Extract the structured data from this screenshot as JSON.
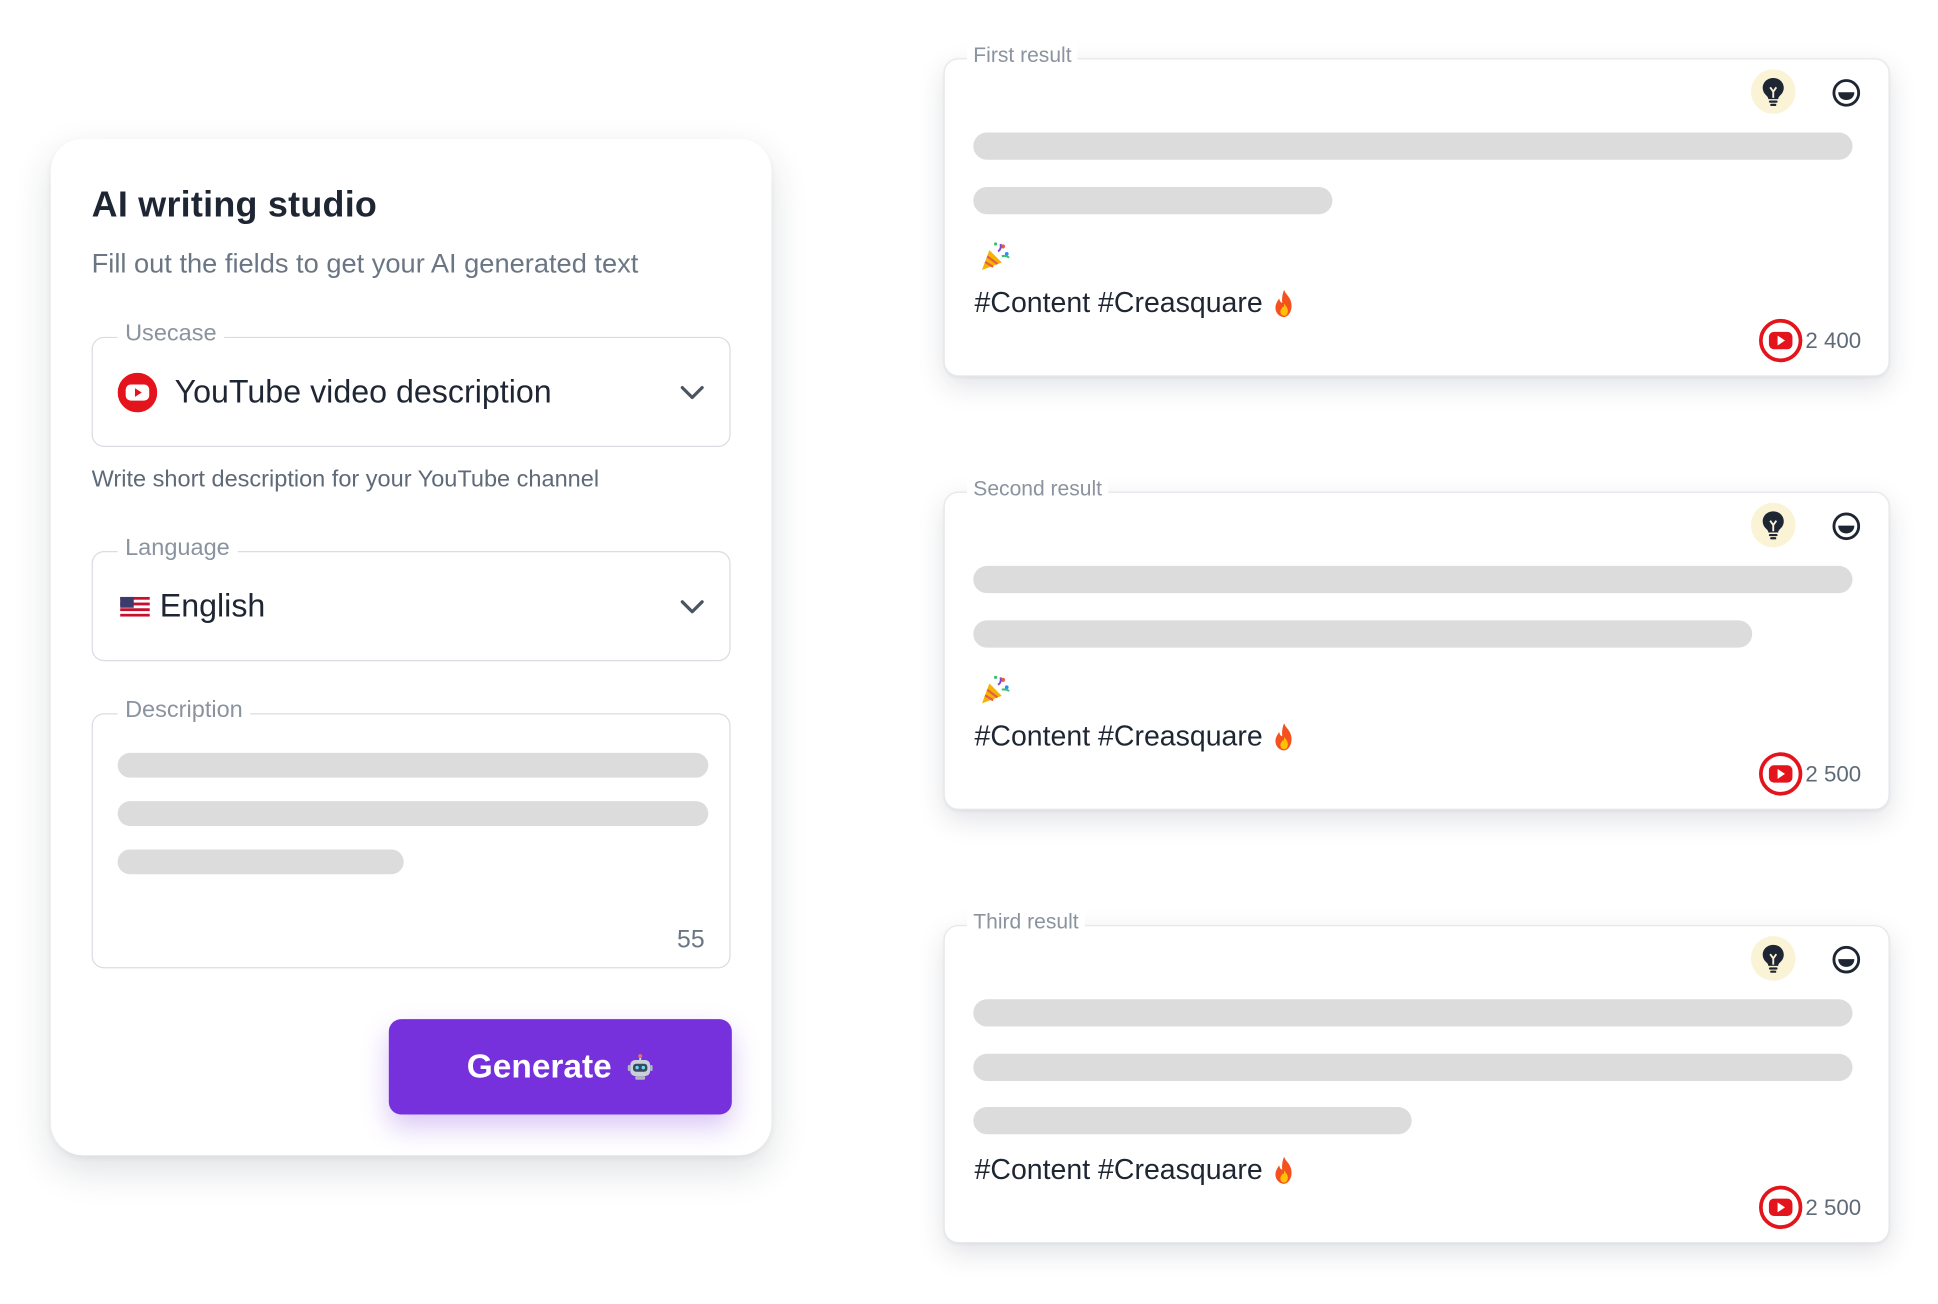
{
  "form": {
    "title": "AI writing studio",
    "subtitle": "Fill out the fields to get your AI generated text",
    "usecase": {
      "label": "Usecase",
      "value": "YouTube video description",
      "icon": "youtube-icon"
    },
    "hint": "Write short description for your YouTube channel",
    "language": {
      "label": "Language",
      "value": "English",
      "icon": "us-flag-icon"
    },
    "description": {
      "label": "Description",
      "char_count": "55"
    },
    "generate_label": "Generate",
    "generate_icon": "robot-icon"
  },
  "results": [
    {
      "label": "First result",
      "hashtags": "#Content #Creasquare",
      "views": "2 400",
      "has_party_icon": true
    },
    {
      "label": "Second result",
      "hashtags": "#Content #Creasquare",
      "views": "2 500",
      "has_party_icon": true
    },
    {
      "label": "Third result",
      "hashtags": "#Content #Creasquare",
      "views": "2 500",
      "has_party_icon": false
    }
  ],
  "colors": {
    "accent": "#7631dc",
    "youtube_red": "#e3141c",
    "skeleton": "#dcdcdc",
    "bulb_bg": "#fbf3d6"
  }
}
